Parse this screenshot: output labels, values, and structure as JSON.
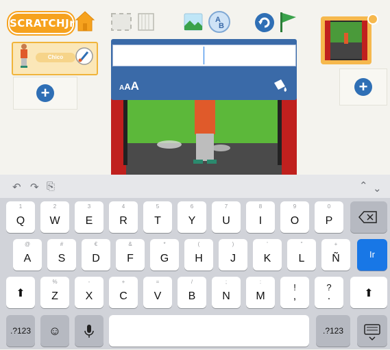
{
  "toolbar": {
    "logo_text": "SCRATCHJr",
    "accent_orange": "#f6a21e",
    "flag_color": "#3aa24b"
  },
  "characters": {
    "selected_name": "Chico"
  },
  "text_editor": {
    "font_size_label": "AAA",
    "panel_color": "#3a6aa8"
  },
  "keyboard": {
    "row1": [
      {
        "hint": "1",
        "key": "Q"
      },
      {
        "hint": "2",
        "key": "W"
      },
      {
        "hint": "3",
        "key": "E"
      },
      {
        "hint": "4",
        "key": "R"
      },
      {
        "hint": "5",
        "key": "T"
      },
      {
        "hint": "6",
        "key": "Y"
      },
      {
        "hint": "7",
        "key": "U"
      },
      {
        "hint": "8",
        "key": "I"
      },
      {
        "hint": "9",
        "key": "O"
      },
      {
        "hint": "0",
        "key": "P"
      }
    ],
    "row2": [
      {
        "hint": "@",
        "key": "A"
      },
      {
        "hint": "#",
        "key": "S"
      },
      {
        "hint": "€",
        "key": "D"
      },
      {
        "hint": "&",
        "key": "F"
      },
      {
        "hint": "*",
        "key": "G"
      },
      {
        "hint": "(",
        "key": "H"
      },
      {
        "hint": ")",
        "key": "J"
      },
      {
        "hint": "'",
        "key": "K"
      },
      {
        "hint": "\"",
        "key": "L"
      },
      {
        "hint": "+",
        "key": "Ñ"
      }
    ],
    "row3": [
      {
        "hint": "%",
        "key": "Z"
      },
      {
        "hint": "-",
        "key": "X"
      },
      {
        "hint": "+",
        "key": "C"
      },
      {
        "hint": "=",
        "key": "V"
      },
      {
        "hint": "/",
        "key": "B"
      },
      {
        "hint": ";",
        "key": "N"
      },
      {
        "hint": ":",
        "key": "M"
      },
      {
        "hint": "!",
        "key": ","
      },
      {
        "hint": "?",
        "key": "."
      }
    ],
    "return_label": "Ir",
    "numbers_label": ".?123",
    "return_color": "#1877e6"
  }
}
